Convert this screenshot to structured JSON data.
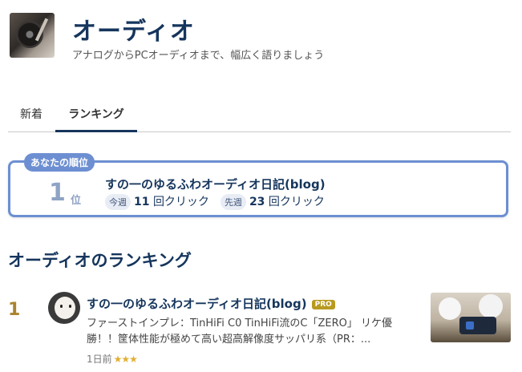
{
  "category": {
    "title": "オーディオ",
    "description": "アナログからPCオーディオまで、幅広く語りましょう"
  },
  "tabs": [
    {
      "label": "新着"
    },
    {
      "label": "ランキング"
    }
  ],
  "my_rank": {
    "badge": "あなたの順位",
    "rank": "1",
    "rank_unit": "位",
    "blog_name": "すの一のゆるふわオーディオ日記(blog)",
    "this_week_label": "今週",
    "this_week_count": "11",
    "this_week_unit": "回クリック",
    "last_week_label": "先週",
    "last_week_count": "23",
    "last_week_unit": "回クリック"
  },
  "ranking": {
    "section_title": "オーディオのランキング",
    "entries": [
      {
        "rank": "1",
        "blog_name": "すの一のゆるふわオーディオ日記(blog)",
        "pro_label": "PRO",
        "description": "ファーストインプレ：TinHiFi C0 TinHiFi流のC「ZERO」 リケ優勝！！筐体性能が極めて高い超高解像度サッパリ系（PR：...",
        "time_ago": "1日前",
        "stars": "★★★"
      }
    ]
  }
}
